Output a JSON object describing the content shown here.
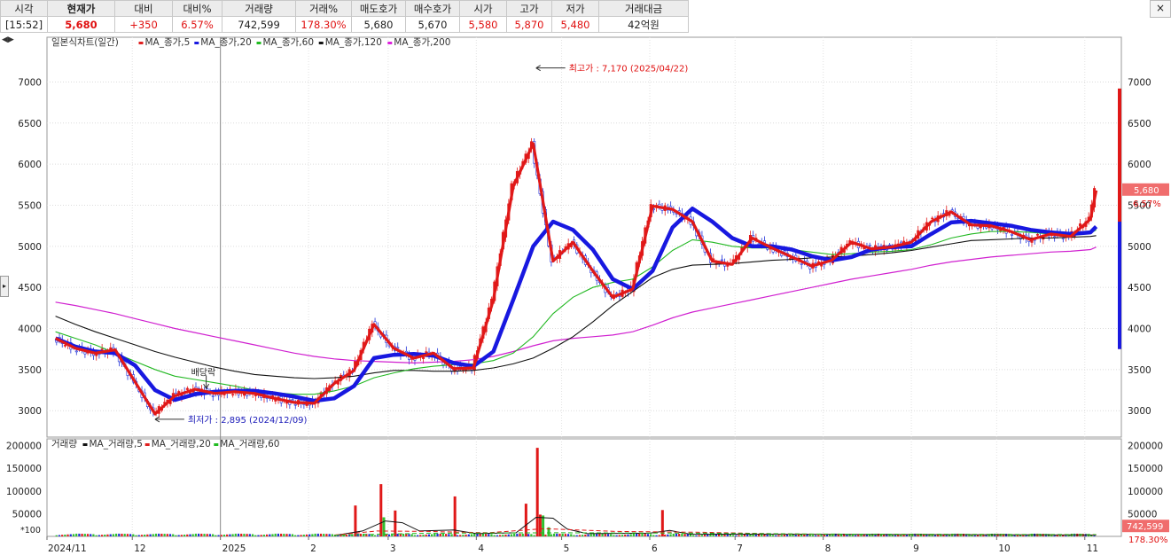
{
  "quote_bar": {
    "headers": [
      "시각",
      "현재가",
      "대비",
      "대비%",
      "거래량",
      "거래%",
      "매도호가",
      "매수호가",
      "시가",
      "고가",
      "저가",
      "거래대금"
    ],
    "values": [
      "[15:52]",
      "5,680",
      "+350",
      "6.57%",
      "742,599",
      "178.30%",
      "5,680",
      "5,670",
      "5,580",
      "5,870",
      "5,480",
      "42억원"
    ],
    "close_button": "×"
  },
  "nav_arrows": "◀▶",
  "side_button": "▸",
  "price_legend": {
    "title": "일본식차트(일간)",
    "items": [
      {
        "label": "MA_종가,5",
        "color": "#e02020"
      },
      {
        "label": "MA_종가,20",
        "color": "#1a1ae0"
      },
      {
        "label": "MA_종가,60",
        "color": "#22bb22"
      },
      {
        "label": "MA_종가,120",
        "color": "#111111"
      },
      {
        "label": "MA_종가,200",
        "color": "#dd22dd"
      }
    ]
  },
  "volume_legend": {
    "title": "거래량",
    "items": [
      {
        "label": "MA_거래량,5",
        "color": "#111111"
      },
      {
        "label": "MA_거래량,20",
        "color": "#e02020"
      },
      {
        "label": "MA_거래량,60",
        "color": "#22bb22"
      }
    ]
  },
  "annotations": {
    "high": "최고가 : 7,170 (2025/04/22)",
    "low": "최저가 : 2,895 (2024/12/09)",
    "dividend": "배당락"
  },
  "current_price_tag": {
    "price": "5,680",
    "pct": "6.57%"
  },
  "current_volume_tag": {
    "volume": "742,599",
    "pct": "178.30%"
  },
  "volume_unit": "*100",
  "chart_data": {
    "type": "candlestick",
    "title": "일본식차트(일간)",
    "price_axis": {
      "ticks": [
        3000,
        3500,
        4000,
        4500,
        5000,
        5500,
        6000,
        6500,
        7000
      ],
      "tick_labels": [
        "3000",
        "3500",
        "4000",
        "4500",
        "5000",
        "5500",
        "6000",
        "6500",
        "7000"
      ],
      "range": [
        2700,
        7350
      ]
    },
    "x_labels": [
      "2024/11",
      "12",
      "2025",
      "2",
      "3",
      "4",
      "5",
      "6",
      "7",
      "8",
      "9",
      "10",
      "11"
    ],
    "close_series": [
      [
        "2024-11-04",
        3880
      ],
      [
        "2024-11-11",
        3760
      ],
      [
        "2024-11-18",
        3700
      ],
      [
        "2024-11-25",
        3740
      ],
      [
        "2024-12-02",
        3350
      ],
      [
        "2024-12-09",
        2960
      ],
      [
        "2024-12-16",
        3180
      ],
      [
        "2024-12-23",
        3260
      ],
      [
        "2024-12-30",
        3210
      ],
      [
        "2025-01-06",
        3230
      ],
      [
        "2025-01-13",
        3210
      ],
      [
        "2025-01-20",
        3150
      ],
      [
        "2025-01-27",
        3100
      ],
      [
        "2025-02-03",
        3090
      ],
      [
        "2025-02-10",
        3330
      ],
      [
        "2025-02-17",
        3490
      ],
      [
        "2025-02-24",
        4050
      ],
      [
        "2025-03-03",
        3760
      ],
      [
        "2025-03-10",
        3640
      ],
      [
        "2025-03-17",
        3700
      ],
      [
        "2025-03-24",
        3510
      ],
      [
        "2025-03-31",
        3520
      ],
      [
        "2025-04-07",
        4350
      ],
      [
        "2025-04-14",
        5730
      ],
      [
        "2025-04-21",
        6250
      ],
      [
        "2025-04-28",
        4820
      ],
      [
        "2025-05-05",
        5050
      ],
      [
        "2025-05-12",
        4700
      ],
      [
        "2025-05-19",
        4380
      ],
      [
        "2025-05-26",
        4480
      ],
      [
        "2025-06-02",
        5490
      ],
      [
        "2025-06-09",
        5450
      ],
      [
        "2025-06-16",
        5300
      ],
      [
        "2025-06-23",
        4820
      ],
      [
        "2025-06-30",
        4780
      ],
      [
        "2025-07-07",
        5100
      ],
      [
        "2025-07-14",
        4980
      ],
      [
        "2025-07-21",
        4870
      ],
      [
        "2025-07-28",
        4760
      ],
      [
        "2025-08-04",
        4830
      ],
      [
        "2025-08-11",
        5050
      ],
      [
        "2025-08-18",
        4970
      ],
      [
        "2025-08-25",
        4990
      ],
      [
        "2025-09-01",
        5050
      ],
      [
        "2025-09-08",
        5300
      ],
      [
        "2025-09-15",
        5420
      ],
      [
        "2025-09-22",
        5260
      ],
      [
        "2025-09-29",
        5250
      ],
      [
        "2025-10-06",
        5180
      ],
      [
        "2025-10-13",
        5080
      ],
      [
        "2025-10-20",
        5150
      ],
      [
        "2025-10-27",
        5120
      ],
      [
        "2025-11-03",
        5330
      ],
      [
        "2025-11-05",
        5680
      ]
    ],
    "moving_averages": {
      "MA_종가,20": [
        3880,
        3780,
        3720,
        3700,
        3550,
        3250,
        3130,
        3200,
        3230,
        3240,
        3240,
        3210,
        3170,
        3120,
        3150,
        3300,
        3640,
        3680,
        3690,
        3670,
        3580,
        3540,
        3720,
        4350,
        5000,
        5300,
        5200,
        4960,
        4600,
        4480,
        4700,
        5230,
        5460,
        5300,
        5100,
        5000,
        5000,
        4960,
        4880,
        4830,
        4870,
        4960,
        4990,
        5000,
        5150,
        5290,
        5310,
        5280,
        5250,
        5200,
        5170,
        5150,
        5170,
        5240
      ],
      "MA_종가,60": [
        3960,
        3880,
        3800,
        3700,
        3600,
        3500,
        3420,
        3380,
        3340,
        3300,
        3250,
        3220,
        3200,
        3200,
        3240,
        3300,
        3400,
        3460,
        3510,
        3540,
        3560,
        3570,
        3610,
        3700,
        3900,
        4180,
        4380,
        4500,
        4560,
        4600,
        4750,
        4950,
        5080,
        5050,
        5000,
        4980,
        4980,
        4960,
        4930,
        4900,
        4910,
        4930,
        4940,
        4960,
        5020,
        5100,
        5150,
        5180,
        5180,
        5170,
        5150,
        5150,
        5160,
        5200
      ],
      "MA_종가,120": [
        4150,
        4050,
        3960,
        3880,
        3800,
        3720,
        3650,
        3590,
        3530,
        3480,
        3440,
        3420,
        3400,
        3390,
        3400,
        3420,
        3460,
        3490,
        3490,
        3480,
        3480,
        3490,
        3520,
        3570,
        3640,
        3760,
        3900,
        4080,
        4280,
        4450,
        4620,
        4720,
        4770,
        4780,
        4790,
        4810,
        4830,
        4840,
        4860,
        4870,
        4880,
        4900,
        4920,
        4950,
        4990,
        5030,
        5070,
        5080,
        5090,
        5100,
        5100,
        5110,
        5120,
        5130
      ],
      "MA_종가,200": [
        4320,
        4280,
        4230,
        4180,
        4120,
        4060,
        4000,
        3950,
        3900,
        3850,
        3800,
        3750,
        3700,
        3660,
        3630,
        3610,
        3600,
        3590,
        3580,
        3590,
        3600,
        3620,
        3660,
        3720,
        3790,
        3850,
        3880,
        3900,
        3920,
        3960,
        4040,
        4130,
        4200,
        4250,
        4300,
        4350,
        4400,
        4450,
        4500,
        4550,
        4600,
        4640,
        4680,
        4720,
        4770,
        4810,
        4840,
        4870,
        4890,
        4910,
        4930,
        4940,
        4960,
        4990
      ]
    },
    "volume_axis": {
      "ticks": [
        50000,
        100000,
        150000,
        200000
      ],
      "tick_labels": [
        "50000",
        "100000",
        "150000",
        "200000"
      ],
      "range": [
        0,
        205000
      ],
      "unit": "*100"
    },
    "volume_spikes": [
      [
        "2025-02-17",
        68000
      ],
      [
        "2025-02-26",
        115000
      ],
      [
        "2025-03-03",
        57000
      ],
      [
        "2025-03-24",
        88000
      ],
      [
        "2025-04-18",
        72000
      ],
      [
        "2025-04-22",
        195000
      ],
      [
        "2025-04-23",
        48000
      ],
      [
        "2025-06-05",
        58000
      ]
    ],
    "annotations": [
      {
        "text": "최고가 : 7,170 (2025/04/22)",
        "value": 7170,
        "date": "2025-04-22"
      },
      {
        "text": "최저가 : 2,895 (2024/12/09)",
        "value": 2895,
        "date": "2024-12-09"
      },
      {
        "text": "배당락",
        "date": "2024-12-27"
      }
    ]
  }
}
